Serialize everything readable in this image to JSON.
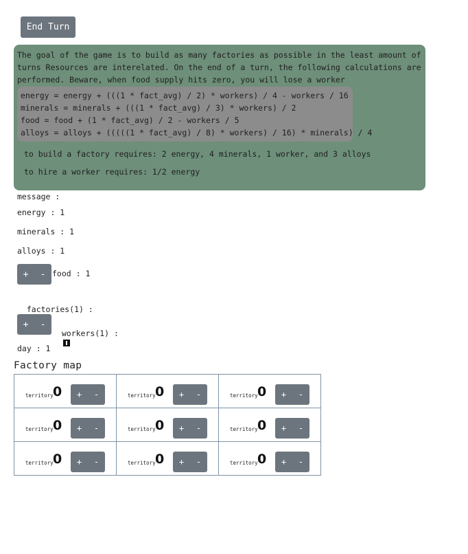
{
  "end_turn_label": "End Turn",
  "info": {
    "goal": "The goal of the game is to build as many factories as possible in the least amount of turns Resources are interelated. On the end of a turn, the following calculations are performed. Beware, when food supply hits zero, you will lose a worker",
    "formulas": [
      "energy = energy + (((1 * fact_avg) / 2) * workers) / 4 - workers / 16",
      "minerals = minerals + (((1 * fact_avg) / 3) * workers) / 2",
      "food = food + (1 * fact_avg) / 2 - workers / 5",
      "alloys = alloys + (((((1 * fact_avg) / 8) * workers) / 16) * minerals) / 4"
    ],
    "factory_requirement": "to build a factory requires: 2 energy, 4 minerals, 1 worker, and 3 alloys",
    "worker_requirement": "to hire a worker requires: 1/2 energy"
  },
  "stats": {
    "message": "message :",
    "energy": "energy : 1",
    "minerals": "minerals : 1",
    "alloys": "alloys : 1",
    "food": "food : 1",
    "factories": "factories(1) :",
    "workers": "workers(1) :",
    "day": "day : 1"
  },
  "plus_label": "+",
  "minus_label": "-",
  "icons": {
    "factory": "factory-icon",
    "worker": "worker-icon"
  },
  "factory_map": {
    "title": "Factory map",
    "cells": [
      {
        "label": "territory",
        "count": "0"
      },
      {
        "label": "territory",
        "count": "0"
      },
      {
        "label": "territory",
        "count": "0"
      },
      {
        "label": "territory",
        "count": "0"
      },
      {
        "label": "territory",
        "count": "0"
      },
      {
        "label": "territory",
        "count": "0"
      },
      {
        "label": "territory",
        "count": "0"
      },
      {
        "label": "territory",
        "count": "0"
      },
      {
        "label": "territory",
        "count": "0"
      }
    ]
  },
  "colors": {
    "button": "#6c757d",
    "info_panel": "#6e8f7a",
    "formula_panel": "#8c8c8c",
    "map_border": "#7e93a6"
  }
}
